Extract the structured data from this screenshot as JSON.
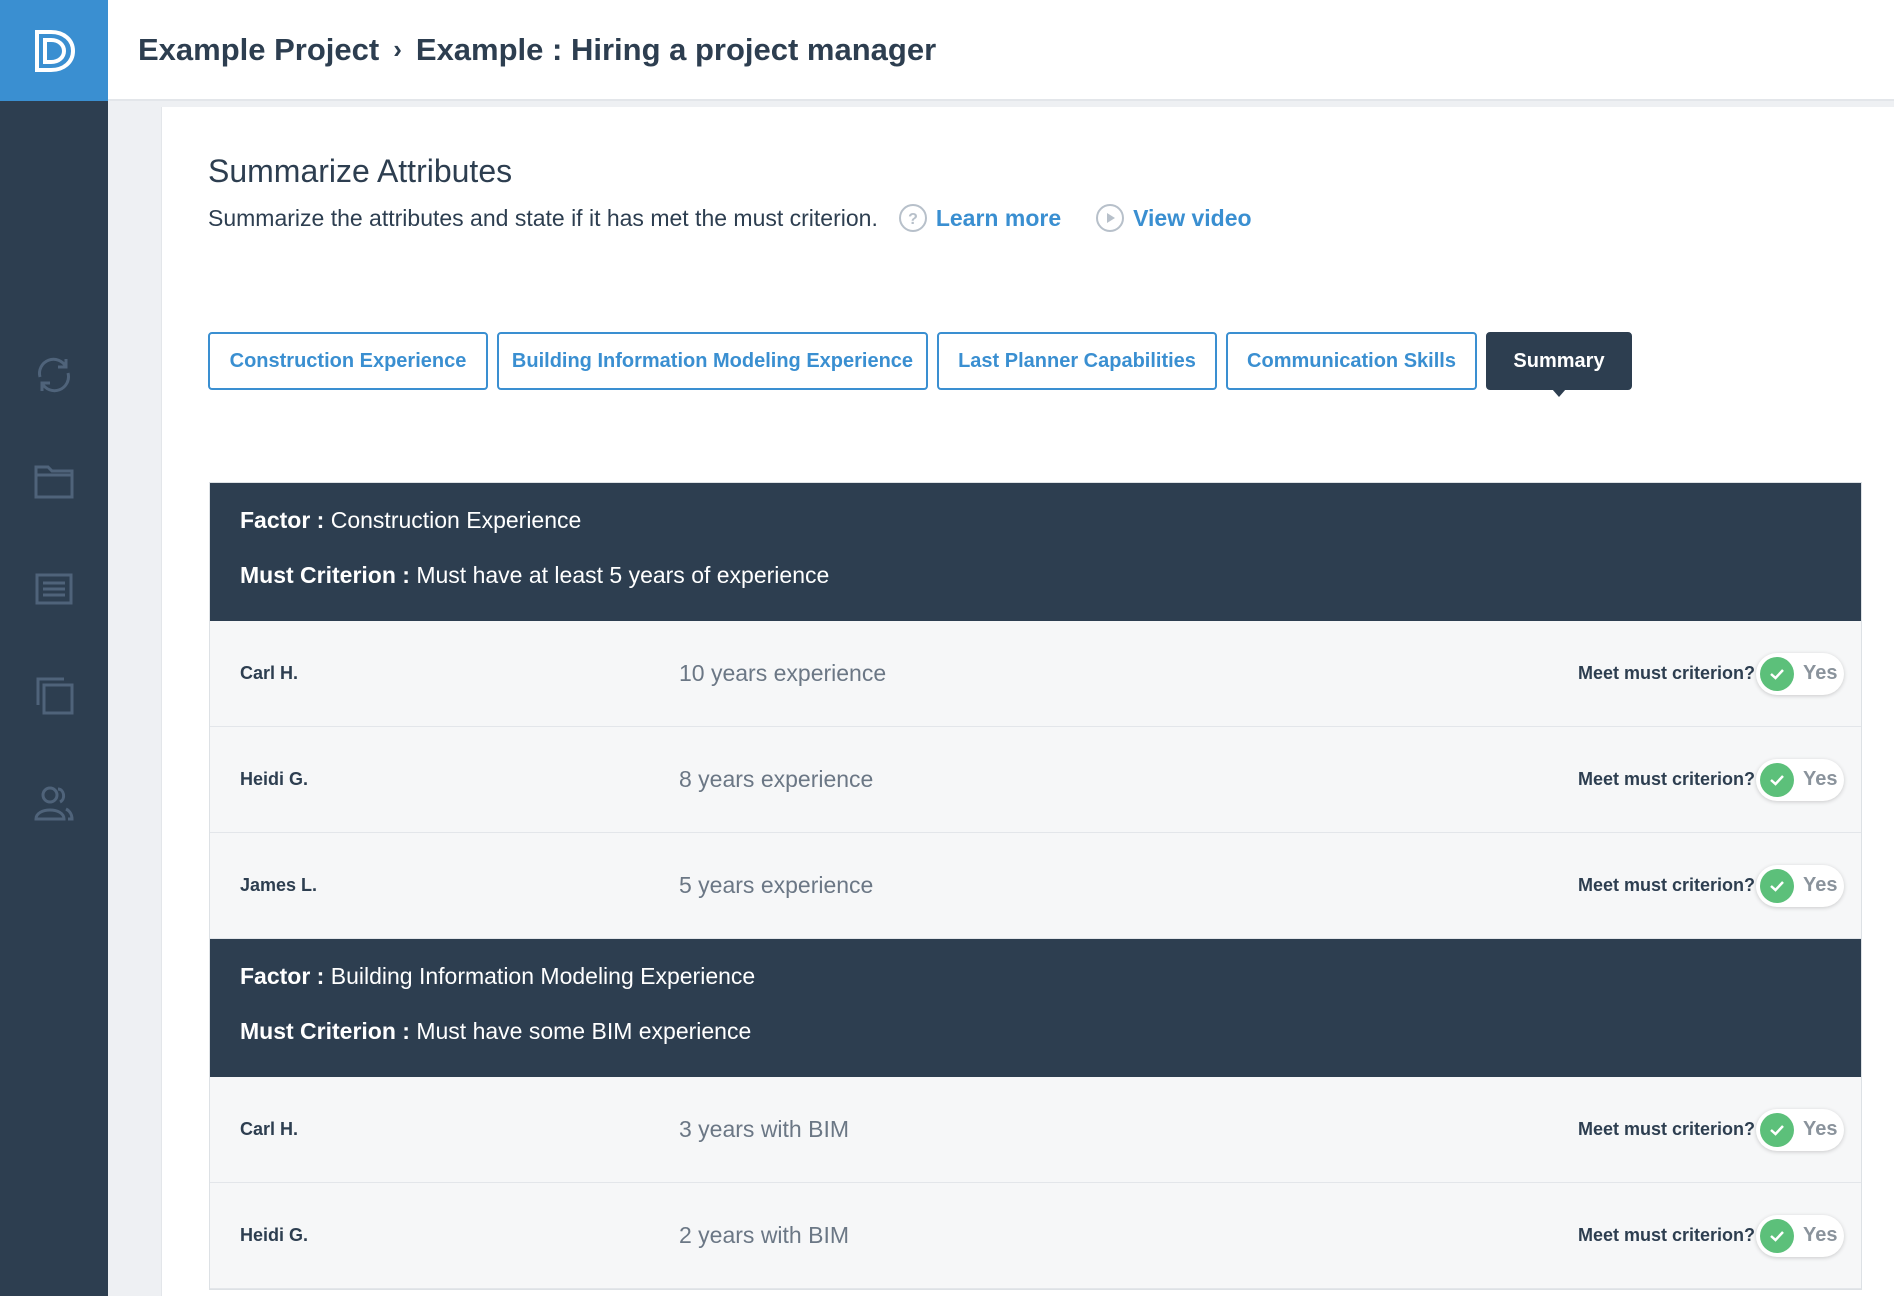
{
  "breadcrumb": {
    "project": "Example Project",
    "separator": "›",
    "page": "Example : Hiring a project manager"
  },
  "sidebar": {
    "items": [
      {
        "icon": "sync-icon"
      },
      {
        "icon": "folder-icon"
      },
      {
        "icon": "list-icon"
      },
      {
        "icon": "layers-icon"
      },
      {
        "icon": "users-icon"
      }
    ]
  },
  "header": {
    "title": "Summarize Attributes",
    "subtitle": "Summarize the attributes and state if it has met the must criterion.",
    "learn_more": "Learn more",
    "view_video": "View video"
  },
  "tabs": [
    {
      "label": "Construction Experience",
      "active": false
    },
    {
      "label": "Building Information Modeling Experience",
      "active": false
    },
    {
      "label": "Last Planner Capabilities",
      "active": false
    },
    {
      "label": "Communication Skills",
      "active": false
    },
    {
      "label": "Summary",
      "active": true
    }
  ],
  "factors": [
    {
      "factor_label": "Factor :",
      "factor_name": "Construction Experience",
      "criterion_label": "Must Criterion :",
      "criterion": "Must have at least 5 years of experience",
      "rows": [
        {
          "name": "Carl H.",
          "value": "10 years experience",
          "meet_label": "Meet must criterion?",
          "toggle": "Yes"
        },
        {
          "name": "Heidi G.",
          "value": "8 years experience",
          "meet_label": "Meet must criterion?",
          "toggle": "Yes"
        },
        {
          "name": "James L.",
          "value": "5 years experience",
          "meet_label": "Meet must criterion?",
          "toggle": "Yes"
        }
      ]
    },
    {
      "factor_label": "Factor :",
      "factor_name": "Building Information Modeling Experience",
      "criterion_label": "Must Criterion :",
      "criterion": "Must have some BIM experience",
      "rows": [
        {
          "name": "Carl H.",
          "value": "3 years with BIM",
          "meet_label": "Meet must criterion?",
          "toggle": "Yes"
        },
        {
          "name": "Heidi G.",
          "value": "2 years with BIM",
          "meet_label": "Meet must criterion?",
          "toggle": "Yes"
        }
      ]
    }
  ],
  "colors": {
    "sidebar": "#2d3e50",
    "accent": "#3a8fd1",
    "success": "#5cc07a"
  }
}
